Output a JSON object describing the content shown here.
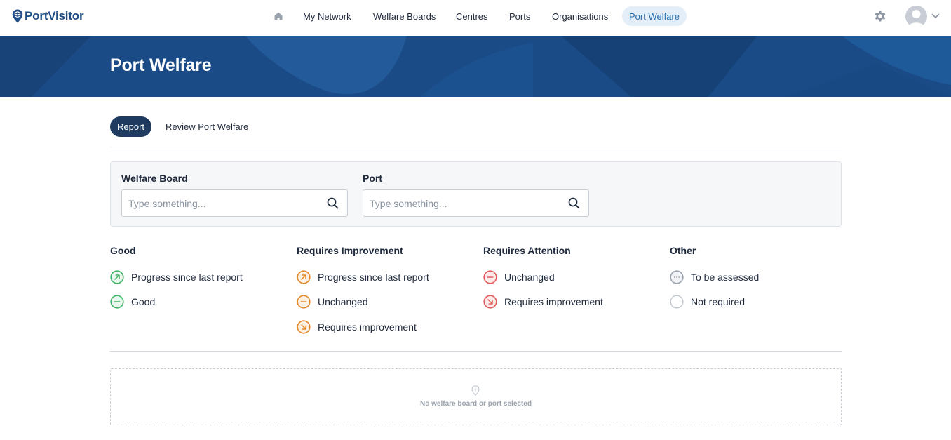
{
  "brand": {
    "name": "PortVisitor",
    "color": "#1f4f86"
  },
  "nav": {
    "home_icon": "home-icon",
    "items": [
      {
        "label": "My Network",
        "active": false
      },
      {
        "label": "Welfare Boards",
        "active": false
      },
      {
        "label": "Centres",
        "active": false
      },
      {
        "label": "Ports",
        "active": false
      },
      {
        "label": "Organisations",
        "active": false
      },
      {
        "label": "Port Welfare",
        "active": true
      }
    ],
    "settings_icon": "gear-icon",
    "avatar_icon": "user-avatar-icon",
    "menu_icon": "chevron-down-icon"
  },
  "banner": {
    "title": "Port Welfare",
    "color": "#1a4b86"
  },
  "tabs": [
    {
      "label": "Report",
      "active": true
    },
    {
      "label": "Review Port Welfare",
      "active": false
    }
  ],
  "filters": {
    "welfare_board": {
      "label": "Welfare Board",
      "placeholder": "Type something...",
      "value": ""
    },
    "port": {
      "label": "Port",
      "placeholder": "Type something...",
      "value": ""
    }
  },
  "legend": [
    {
      "heading": "Good",
      "color": "#3fb567",
      "items": [
        {
          "label": "Progress since last report",
          "icon": "arrow-up-right-icon"
        },
        {
          "label": "Good",
          "icon": "minus-icon"
        }
      ]
    },
    {
      "heading": "Requires Improvement",
      "color": "#e38a2e",
      "items": [
        {
          "label": "Progress since last report",
          "icon": "arrow-up-right-icon"
        },
        {
          "label": "Unchanged",
          "icon": "minus-icon"
        },
        {
          "label": "Requires improvement",
          "icon": "arrow-down-right-icon"
        }
      ]
    },
    {
      "heading": "Requires Attention",
      "color": "#e05a5a",
      "items": [
        {
          "label": "Unchanged",
          "icon": "minus-icon"
        },
        {
          "label": "Requires improvement",
          "icon": "arrow-down-right-icon"
        }
      ]
    },
    {
      "heading": "Other",
      "color": "#9aa3ad",
      "items": [
        {
          "label": "To be assessed",
          "icon": "ellipsis-icon"
        },
        {
          "label": "Not required",
          "icon": "empty-circle-icon"
        }
      ]
    }
  ],
  "empty_state": {
    "icon": "map-pin-icon",
    "message": "No welfare board or port selected"
  }
}
